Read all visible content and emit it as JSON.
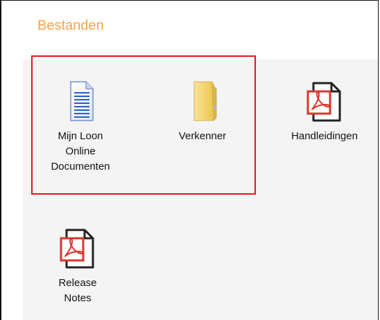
{
  "section": {
    "title": "Bestanden"
  },
  "tiles": [
    {
      "label_lines": [
        "Mijn Loon",
        "Online",
        "Documenten"
      ],
      "icon": "document-icon"
    },
    {
      "label_lines": [
        "Verkenner"
      ],
      "icon": "folder-icon"
    },
    {
      "label_lines": [
        "Handleidingen"
      ],
      "icon": "pdf-icon"
    },
    {
      "label_lines": [
        "Release",
        "Notes"
      ],
      "icon": "pdf-icon"
    }
  ],
  "colors": {
    "title": "#f7a342",
    "panel_background": "#f4f4f4",
    "highlight_border": "#e8101c",
    "pdf_red": "#d9352b",
    "folder_yellow": "#f5d76b"
  }
}
